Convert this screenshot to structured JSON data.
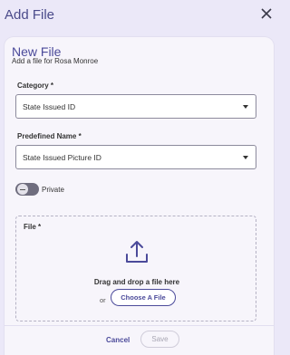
{
  "window": {
    "title": "Add File",
    "close_icon": "close-icon"
  },
  "form": {
    "heading": "New File",
    "subheading": "Add a file for Rosa Monroe",
    "category": {
      "label": "Category *",
      "value": "State Issued ID"
    },
    "predefined_name": {
      "label": "Predefined Name *",
      "value": "State Issued Picture ID"
    },
    "private_toggle": {
      "label": "Private",
      "state": "off"
    },
    "file": {
      "label": "File *",
      "icon": "upload-icon",
      "drag_text": "Drag and drop a file here",
      "or_text": "or",
      "choose_label": "Choose A File"
    }
  },
  "footer": {
    "cancel_label": "Cancel",
    "save_label": "Save"
  },
  "colors": {
    "accent": "#4b4a9a",
    "background": "#ebe8f8"
  }
}
